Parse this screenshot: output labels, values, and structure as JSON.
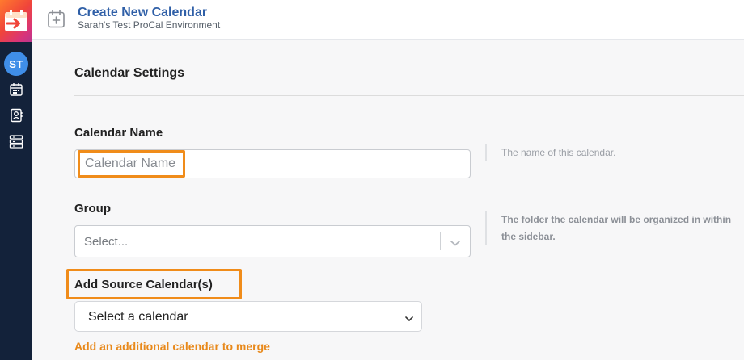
{
  "sidebar": {
    "avatar_initials": "ST",
    "icons": [
      "calendar-icon",
      "contact-card-icon",
      "server-icon"
    ]
  },
  "header": {
    "title": "Create New Calendar",
    "subtitle": "Sarah's Test ProCal Environment"
  },
  "form": {
    "section_title": "Calendar Settings",
    "calendar_name": {
      "label": "Calendar Name",
      "placeholder": "Calendar Name",
      "value": "",
      "help": "The name of this calendar."
    },
    "group": {
      "label": "Group",
      "selected": "Select...",
      "help": "The folder the calendar will be organized in within the sidebar."
    },
    "source_calendars": {
      "label": "Add Source Calendar(s)",
      "selected": "Select a calendar",
      "add_link": "Add an additional calendar to merge"
    }
  },
  "colors": {
    "sidebar": "#13223a",
    "title": "#2f5fa7",
    "highlight": "#f08c1a",
    "link": "#e8891b",
    "avatar": "#3f8ee8"
  }
}
